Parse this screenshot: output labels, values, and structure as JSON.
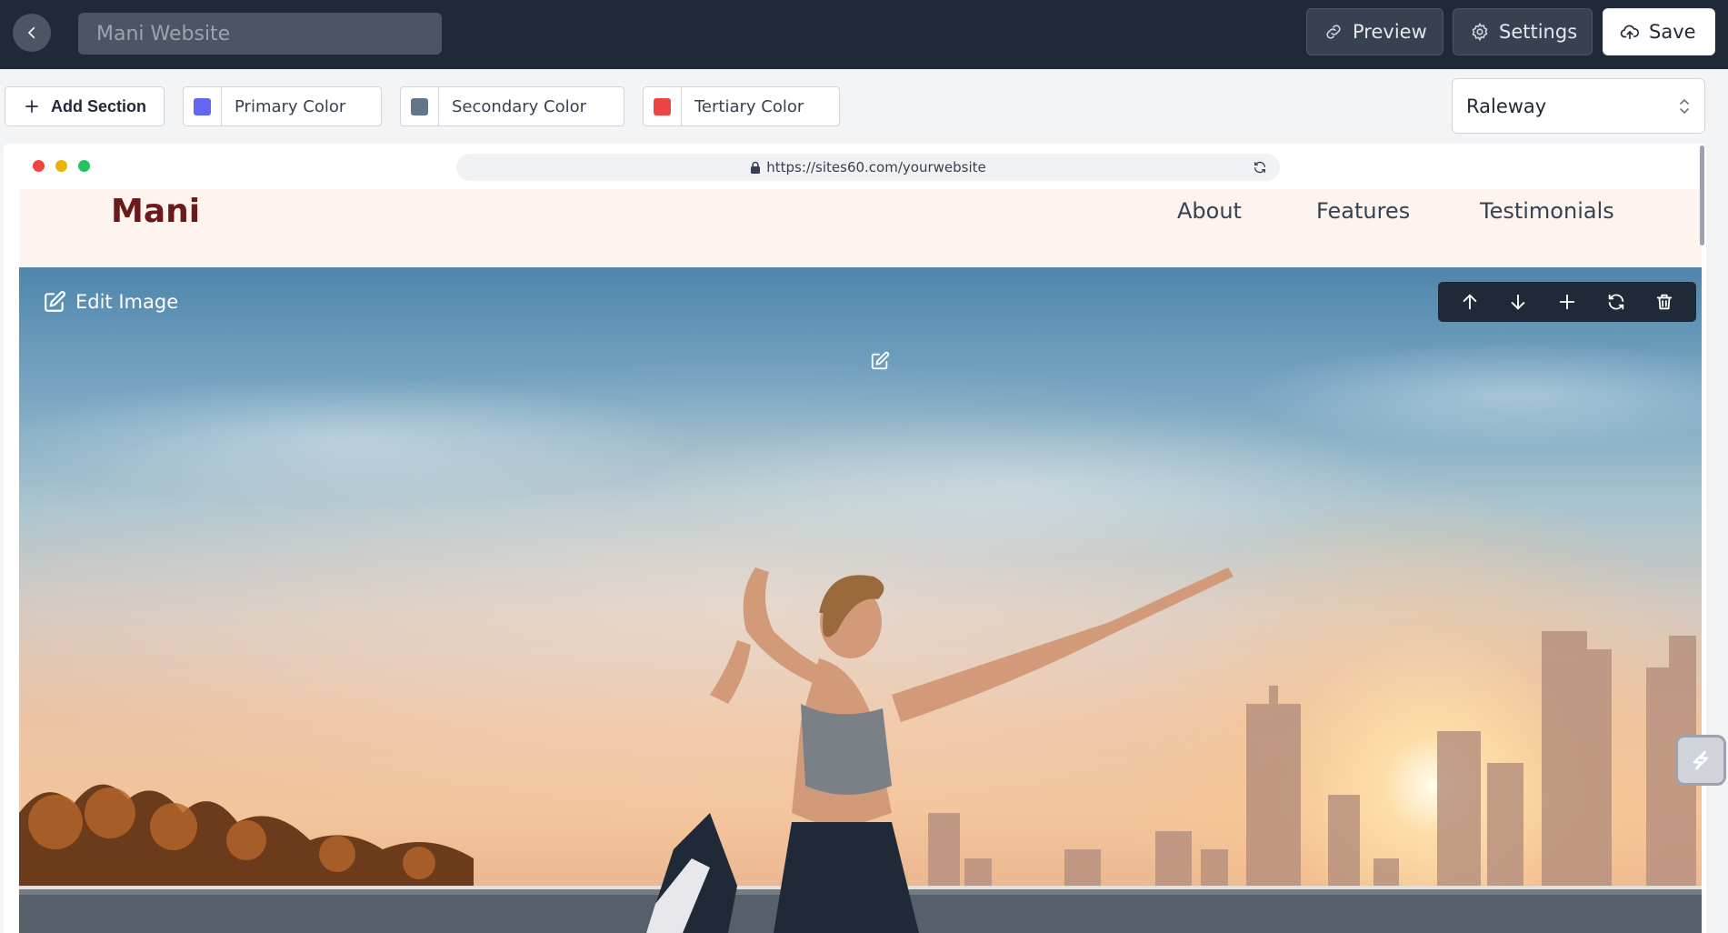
{
  "header": {
    "site_title_value": "Mani Website",
    "preview_label": "Preview",
    "settings_label": "Settings",
    "save_label": "Save"
  },
  "toolbar": {
    "add_section_label": "Add Section",
    "colors": [
      {
        "label": "Primary Color",
        "swatch": "#6366f1"
      },
      {
        "label": "Secondary Color",
        "swatch": "#64748b"
      },
      {
        "label": "Tertiary Color",
        "swatch": "#ef4444"
      }
    ],
    "font_value": "Raleway"
  },
  "browser": {
    "url": "https://sites60.com/yourwebsite",
    "dot_colors": [
      "#ef4444",
      "#eab308",
      "#22c55e"
    ]
  },
  "site": {
    "logo": "Mani",
    "nav": [
      "About",
      "Features",
      "Testimonials"
    ],
    "hero": {
      "edit_image_label": "Edit Image"
    }
  },
  "icons": {
    "back": "chevron-left-icon",
    "preview": "link-icon",
    "settings": "gear-icon",
    "save": "cloud-upload-icon",
    "add": "plus-icon",
    "font_select": "chevron-up-down-icon",
    "url_lock": "lock-icon",
    "url_reload": "reload-icon",
    "edit": "edit-icon",
    "section_controls": [
      "arrow-up-icon",
      "arrow-down-icon",
      "plus-icon",
      "refresh-icon",
      "trash-icon"
    ]
  },
  "colors": {
    "topbar_bg": "#1f2937",
    "logo": "#6b1a1a",
    "nav_bg": "#fdf3ef"
  }
}
